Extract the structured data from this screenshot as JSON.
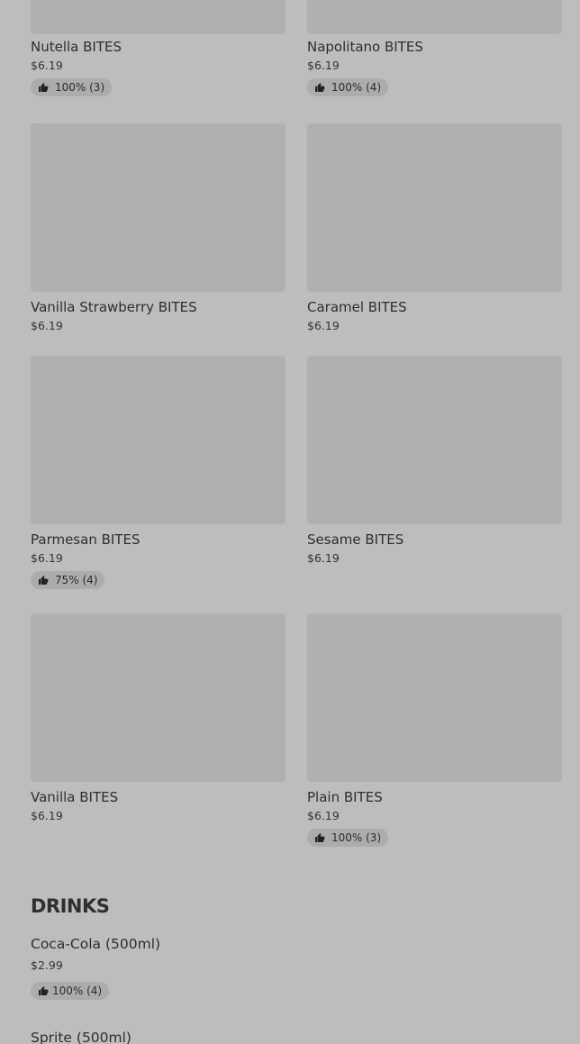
{
  "products": [
    {
      "name": "Nutella BITES",
      "price": "$6.19",
      "rating": "100% (3)"
    },
    {
      "name": "Napolitano BITES",
      "price": "$6.19",
      "rating": "100% (4)"
    },
    {
      "name": "Vanilla Strawberry BITES",
      "price": "$6.19"
    },
    {
      "name": "Caramel BITES",
      "price": "$6.19"
    },
    {
      "name": "Parmesan BITES",
      "price": "$6.19",
      "rating": "75% (4)"
    },
    {
      "name": "Sesame BITES",
      "price": "$6.19"
    },
    {
      "name": "Vanilla BITES",
      "price": "$6.19"
    },
    {
      "name": "Plain BITES",
      "price": "$6.19",
      "rating": "100% (3)"
    }
  ],
  "drinks_section": {
    "title": "DRINKS",
    "items": [
      {
        "name": "Coca-Cola (500ml)",
        "price": "$2.99",
        "rating": "100% (4)"
      },
      {
        "name": "Sprite (500ml)"
      }
    ]
  },
  "icons": {
    "rating": "thumbs-up-icon"
  }
}
